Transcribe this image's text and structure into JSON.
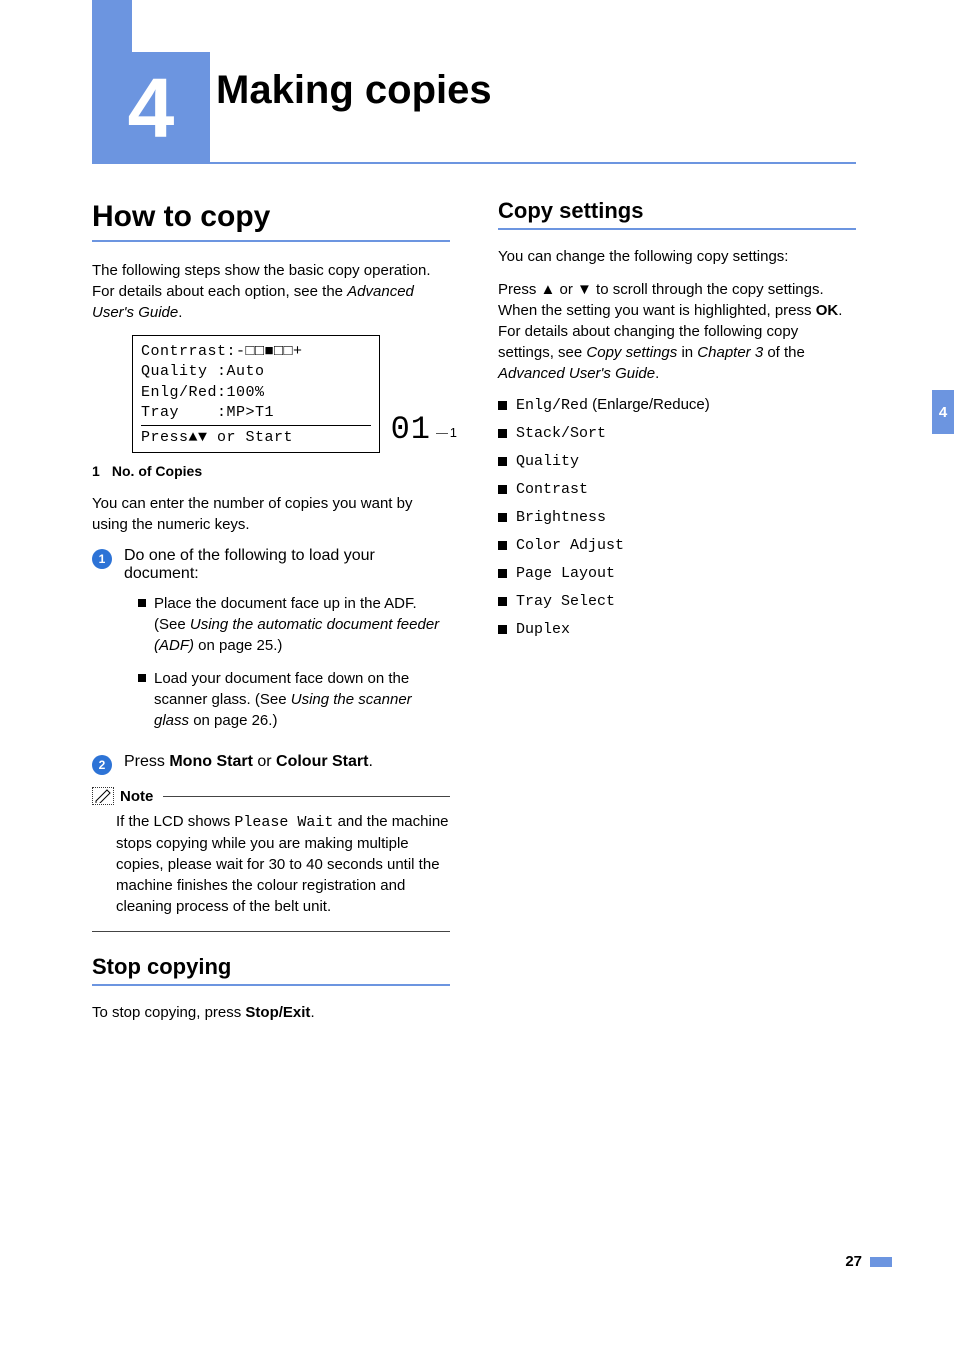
{
  "chapter": {
    "number": "4",
    "title": "Making copies"
  },
  "tab": "4",
  "page_number": "27",
  "left": {
    "heading": "How to copy",
    "intro_pre": "The following steps show the basic copy operation. For details about each option, see the ",
    "intro_ital": "Advanced User's Guide",
    "intro_post": ".",
    "lcd": {
      "l1": "Contrrast:-□□■□□+",
      "l2": "Quality :Auto",
      "l3": "Enlg/Red:100%",
      "l4": "Tray    :MP>T1",
      "l5": "Press▲▼ or Start",
      "copies": "01",
      "callout": "1"
    },
    "legend": {
      "num": "1",
      "label": "No. of Copies"
    },
    "numcopies": "You can enter the number of copies you want by using the numeric keys.",
    "step1": {
      "num": "1",
      "text": "Do one of the following to load your document:",
      "b1_pre": "Place the document face up in the ADF. (See ",
      "b1_ital": "Using the automatic document feeder (ADF)",
      "b1_post": " on page 25.)",
      "b2_pre": "Load your document face down on the scanner glass. (See ",
      "b2_ital": "Using the scanner glass",
      "b2_post": " on page 26.)"
    },
    "step2": {
      "num": "2",
      "pre": "Press ",
      "b1": "Mono Start",
      "mid": " or ",
      "b2": "Colour Start",
      "post": "."
    },
    "note": {
      "label": "Note",
      "pre": "If the LCD shows ",
      "mono": "Please Wait",
      "post": " and the machine stops copying while you are making multiple copies, please wait for 30 to 40 seconds until the machine finishes the colour registration and cleaning process of the belt unit."
    },
    "stop": {
      "heading": "Stop copying",
      "pre": "To stop copying, press ",
      "bold": "Stop/Exit",
      "post": "."
    }
  },
  "right": {
    "heading": "Copy settings",
    "l1": "You can change the following copy settings:",
    "p2": {
      "s1": "Press ▲ or ▼ to scroll through the copy settings. When the setting you want is highlighted, press ",
      "ok": "OK",
      "s2": ". For details about changing the following copy settings, see ",
      "i1": "Copy settings",
      "s3": " in ",
      "i2": "Chapter 3",
      "s4": " of the ",
      "i3": "Advanced User's Guide",
      "s5": "."
    },
    "items": {
      "i0_code": "Enlg/Red",
      "i0_paren": " (Enlarge/Reduce)",
      "i1": "Stack/Sort",
      "i2": "Quality",
      "i3": "Contrast",
      "i4": "Brightness",
      "i5": "Color Adjust",
      "i6": "Page Layout",
      "i7": "Tray Select",
      "i8": "Duplex"
    }
  }
}
